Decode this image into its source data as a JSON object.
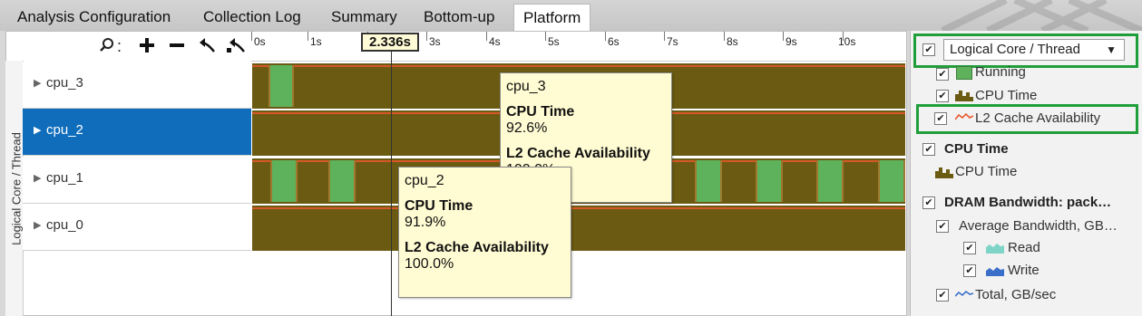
{
  "tabs": [
    "Analysis Configuration",
    "Collection Log",
    "Summary",
    "Bottom-up",
    "Platform"
  ],
  "active_tab": "Platform",
  "vertical_label": "Logical Core / Thread",
  "toolbar": {
    "search_icon": "search-icon",
    "zoom_in_icon": "plus-icon",
    "zoom_out_icon": "minus-icon",
    "undo_zoom_icon": "undo-zoom-icon",
    "reset_zoom_icon": "reset-zoom-icon",
    "separator": ":"
  },
  "ruler": {
    "ticks": [
      "0s",
      "1s",
      "2s",
      "3s",
      "4s",
      "5s",
      "6s",
      "7s",
      "8s",
      "9s",
      "10s"
    ],
    "cursor_time": "2.336s"
  },
  "rows": [
    {
      "label": "cpu_3",
      "selected": false
    },
    {
      "label": "cpu_2",
      "selected": true
    },
    {
      "label": "cpu_1",
      "selected": false
    },
    {
      "label": "cpu_0",
      "selected": false
    }
  ],
  "tooltips": [
    {
      "title": "cpu_3",
      "metric1": "CPU Time",
      "value1": "92.6%",
      "metric2": "L2 Cache Availability",
      "value2": "100.0%"
    },
    {
      "title": "cpu_2",
      "metric1": "CPU Time",
      "value1": "91.9%",
      "metric2": "L2 Cache Availability",
      "value2": "100.0%"
    }
  ],
  "legend": {
    "dropdown": "Logical Core / Thread",
    "items": [
      {
        "label": "Running",
        "indent": 1
      },
      {
        "label": "CPU Time",
        "indent": 1
      },
      {
        "label": "L2 Cache Availability",
        "indent": 1
      },
      {
        "label": "CPU Time",
        "indent": 0,
        "bold": true
      },
      {
        "label": "CPU Time",
        "indent": 1
      },
      {
        "label": "DRAM Bandwidth: pack…",
        "indent": 0,
        "bold": true
      },
      {
        "label": "Average Bandwidth, GB…",
        "indent": 1
      },
      {
        "label": "Read",
        "indent": 2
      },
      {
        "label": "Write",
        "indent": 2
      },
      {
        "label": "Total, GB/sec",
        "indent": 1
      }
    ]
  },
  "colors": {
    "lane_bg": "#6b5a12",
    "running": "#5db25b",
    "cache_line": "#e7582c",
    "selected": "#0f6dbb",
    "highlight": "#1f9e3a",
    "tooltip_bg": "#fffbd2"
  }
}
